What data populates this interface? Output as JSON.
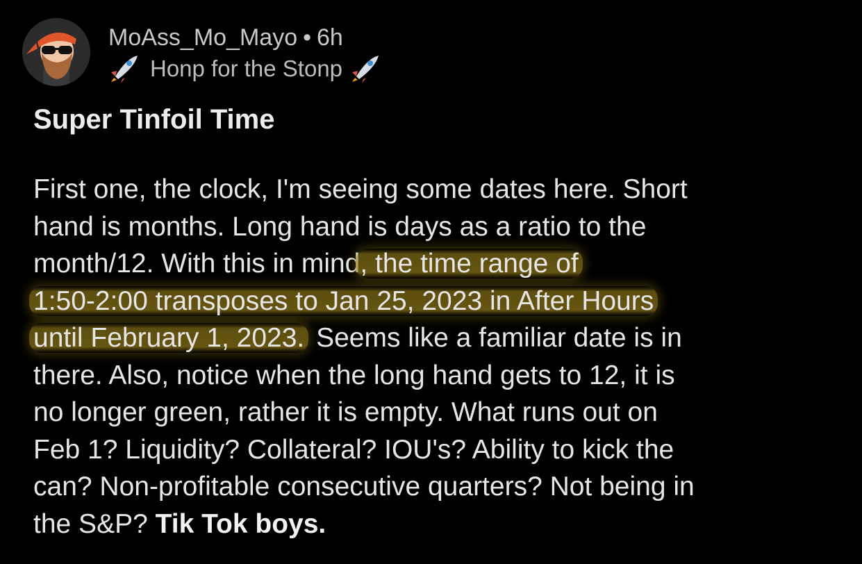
{
  "post": {
    "username": "MoAss_Mo_Mayo",
    "separator": "•",
    "age": "6h",
    "flair": "Honp for the Stonp",
    "flair_icon": "rocket-icon",
    "title": "Super Tinfoil Time"
  },
  "body": {
    "line1": "First one, the clock, I'm seeing some dates here. Short",
    "line2": "hand is months. Long hand is days as a ratio to the",
    "line3_a": "month/12. With this in mind",
    "line3_b": ", the time range of",
    "line4": "1:50-2:00 transposes to Jan 25, 2023 in After Hours",
    "line5_a": "until February 1, 2023.",
    "line5_b": " Seems like a familiar date is in",
    "line6": "there. Also, notice when the long hand gets to 12, it is",
    "line7": "no longer green, rather it is empty. What runs out on",
    "line8": "Feb 1? Liquidity? Collateral? IOU's? Ability to kick the",
    "line9": "can? Non-profitable consecutive quarters? Not being in",
    "line10_a": "the S&P? ",
    "line10_b": "Tik Tok boys."
  },
  "colors": {
    "background": "#000000",
    "text": "#e6e6e6",
    "highlight": "#967d19"
  }
}
